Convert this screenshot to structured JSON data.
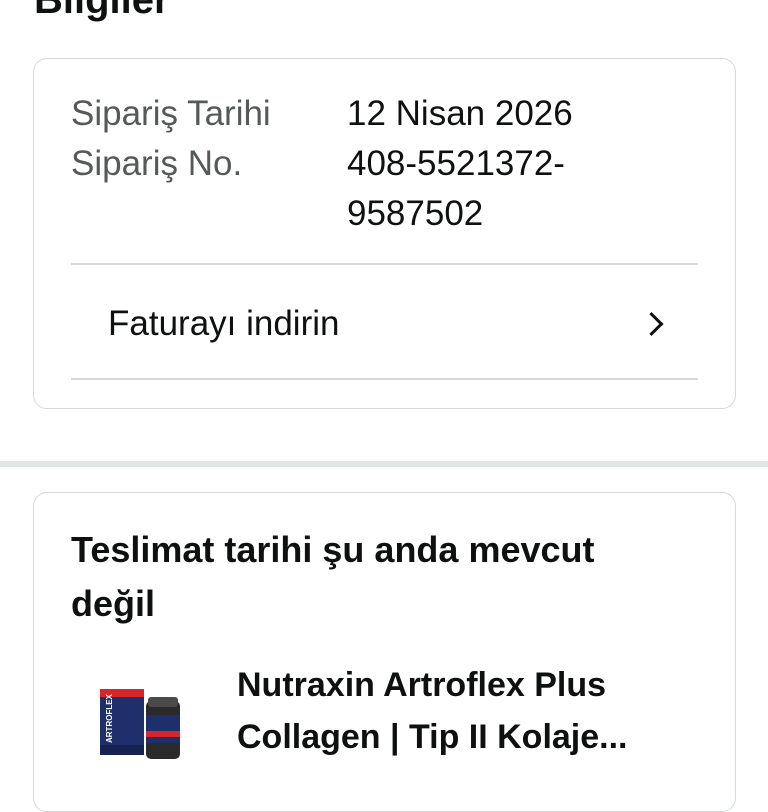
{
  "header": {
    "section_title": "Bilgiler"
  },
  "order_details": {
    "order_date_label": "Sipariş Tarihi",
    "order_date_value": "12 Nisan 2026",
    "order_no_label": "Sipariş No.",
    "order_no_value_line1": "408-5521372-",
    "order_no_value_line2": "9587502",
    "invoice_link_label": "Faturayı indirin"
  },
  "delivery": {
    "title": "Teslimat tarihi şu anda mevcut değil",
    "product_name": "Nutraxin Artroflex Plus Collagen | Tip II Kolaje...",
    "product_thumb_text": "ARTROFLEX"
  },
  "icons": {
    "chevron": "chevron-right-icon"
  },
  "colors": {
    "text": "#0f1111",
    "muted": "#565959",
    "border": "#d5d9d9",
    "separator": "#e3e6e6"
  }
}
